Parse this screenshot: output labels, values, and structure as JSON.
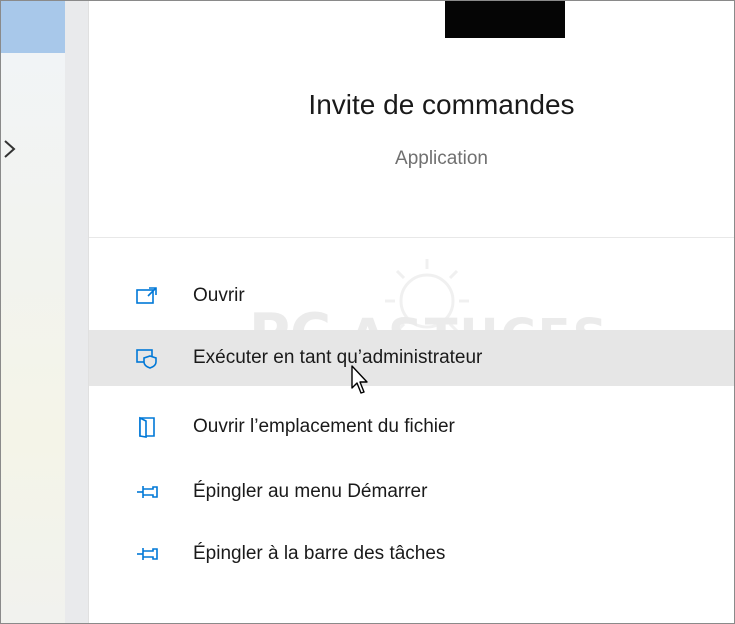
{
  "app": {
    "title": "Invite de commandes",
    "type_label": "Application"
  },
  "menu": {
    "items": [
      {
        "label": "Ouvrir",
        "icon": "open-icon"
      },
      {
        "label": "Exécuter en tant qu’administrateur",
        "icon": "admin-shield-icon",
        "highlighted": true
      },
      {
        "label": "Ouvrir l’emplacement du fichier",
        "icon": "file-location-icon"
      },
      {
        "label": "Épingler au menu Démarrer",
        "icon": "pin-icon"
      },
      {
        "label": "Épingler à la barre des tâches",
        "icon": "pin-icon"
      }
    ]
  },
  "colors": {
    "accent": "#0078d7",
    "hover_bg": "#e6e6e6",
    "left_selection": "#a8c8ea"
  },
  "watermark": {
    "text": "PCASTUCES"
  }
}
